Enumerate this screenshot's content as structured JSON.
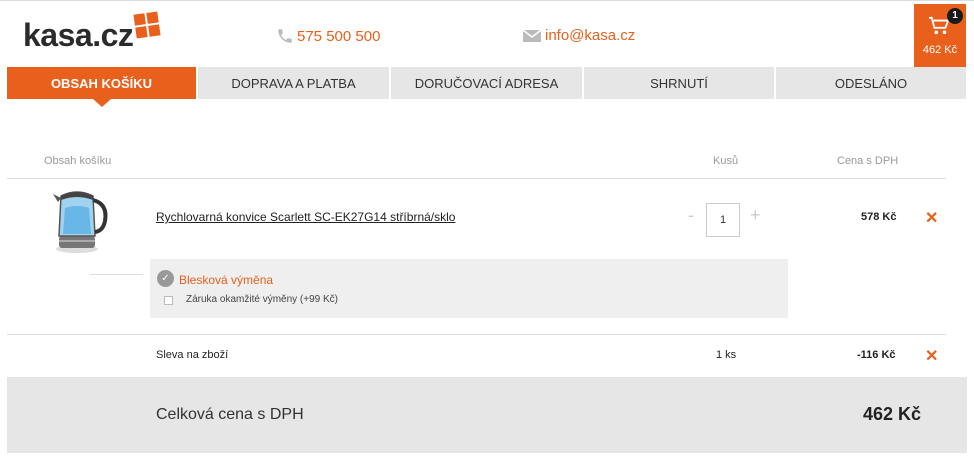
{
  "header": {
    "logo_text": "kasa.cz",
    "phone": "575 500 500",
    "email": "info@kasa.cz",
    "cart": {
      "count": "1",
      "price": "462 Kč"
    }
  },
  "tabs": [
    {
      "label": "Obsah košíku",
      "active": true
    },
    {
      "label": "Doprava a platba",
      "active": false
    },
    {
      "label": "Doručovací adresa",
      "active": false
    },
    {
      "label": "Shrnutí",
      "active": false
    },
    {
      "label": "Odesláno",
      "active": false
    }
  ],
  "table": {
    "headers": {
      "content": "Obsah košíku",
      "qty": "Kusů",
      "price": "Cena s DPH"
    },
    "item": {
      "name": "Rychlovarná konvice Scarlett SC-EK27G14 stříbrná/sklo",
      "quantity": "1",
      "price": "578 Kč",
      "qty_minus": "-",
      "qty_plus": "+",
      "remove": "✕"
    },
    "service": {
      "title": "Blesková výměna",
      "option_label": "Záruka okamžité výměny (+99 Kč)",
      "checked": false
    },
    "discount": {
      "label": "Sleva na zboží",
      "qty": "1 ks",
      "price": "-116 Kč",
      "remove": "✕"
    }
  },
  "total": {
    "label": "Celková cena s DPH",
    "value": "462 Kč"
  },
  "colors": {
    "accent": "#e8601c",
    "tab_bg": "#e6e6e6",
    "dark": "#2b2b2b"
  }
}
